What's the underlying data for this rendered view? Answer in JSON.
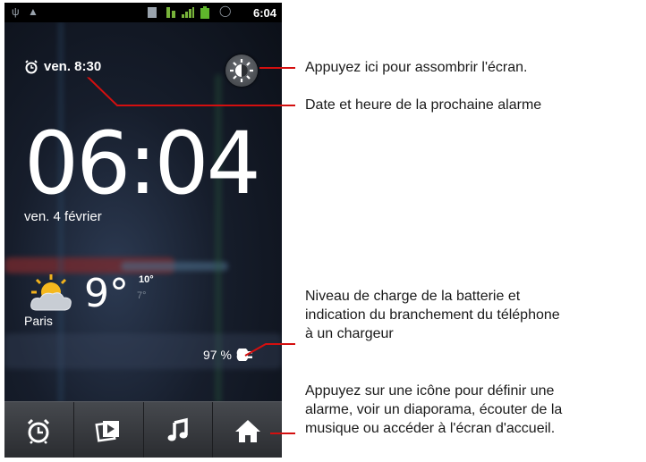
{
  "status_bar": {
    "time": "6:04"
  },
  "widget": {
    "next_alarm": "ven. 8:30",
    "clock": "06:04",
    "date": "ven. 4 février",
    "weather": {
      "temp": "9°",
      "high": "10°",
      "low": "7°",
      "city": "Paris"
    },
    "battery_level": "97 %"
  },
  "dock": {
    "icons": [
      "alarm-clock-icon",
      "slideshow-icon",
      "music-note-icon",
      "home-icon"
    ]
  },
  "annotations": {
    "dim": "Appuyez ici pour assombrir l'écran.",
    "alarm": "Date et heure de la prochaine alarme",
    "battery_line1": "Niveau de charge de la batterie et",
    "battery_line2": "indication du branchement du téléphone",
    "battery_line3": "à un chargeur",
    "dock_line1": "Appuyez sur une icône pour définir une",
    "dock_line2": "alarme, voir un diaporama, écouter de la",
    "dock_line3": "musique ou accéder à l'écran d'accueil."
  },
  "colors": {
    "callout_line": "#d40f0f",
    "dock": "#3a3c40"
  }
}
